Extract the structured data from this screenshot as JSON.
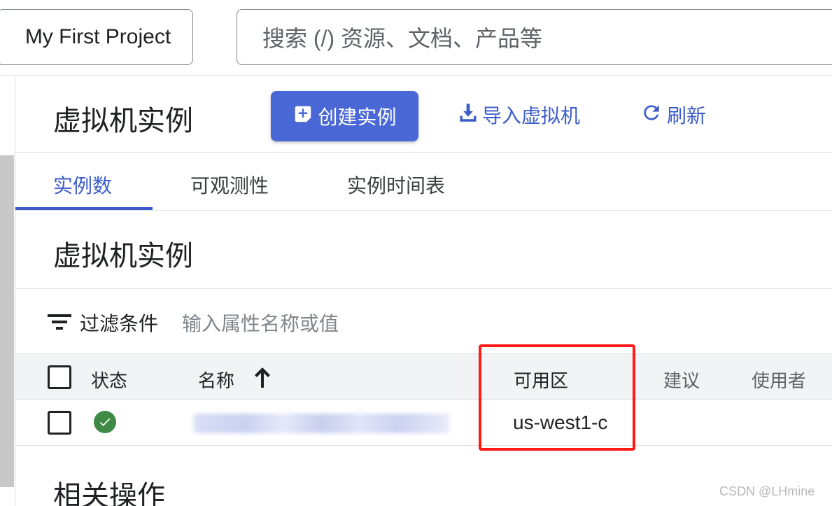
{
  "topbar": {
    "project_label": "My First Project",
    "search_placeholder": "搜索 (/) 资源、文档、产品等"
  },
  "header": {
    "title": "虚拟机实例",
    "create_label": "创建实例",
    "import_label": "导入虚拟机",
    "refresh_label": "刷新"
  },
  "tabs": [
    {
      "label": "实例数",
      "active": true
    },
    {
      "label": "可观测性",
      "active": false
    },
    {
      "label": "实例时间表",
      "active": false
    }
  ],
  "section": {
    "title": "虚拟机实例",
    "filter_label": "过滤条件",
    "filter_placeholder": "输入属性名称或值"
  },
  "table": {
    "columns": [
      "状态",
      "名称",
      "可用区",
      "建议",
      "使用者"
    ],
    "rows": [
      {
        "status": "running-ok",
        "name": "",
        "zone": "us-west1-c"
      }
    ]
  },
  "related": {
    "title": "相关操作"
  },
  "watermark": "CSDN @LHmine",
  "colors": {
    "accent": "#3c5cc9",
    "primary_button": "#4a67d6",
    "status_ok": "#3f8b46",
    "highlight": "#ff1a1a"
  }
}
